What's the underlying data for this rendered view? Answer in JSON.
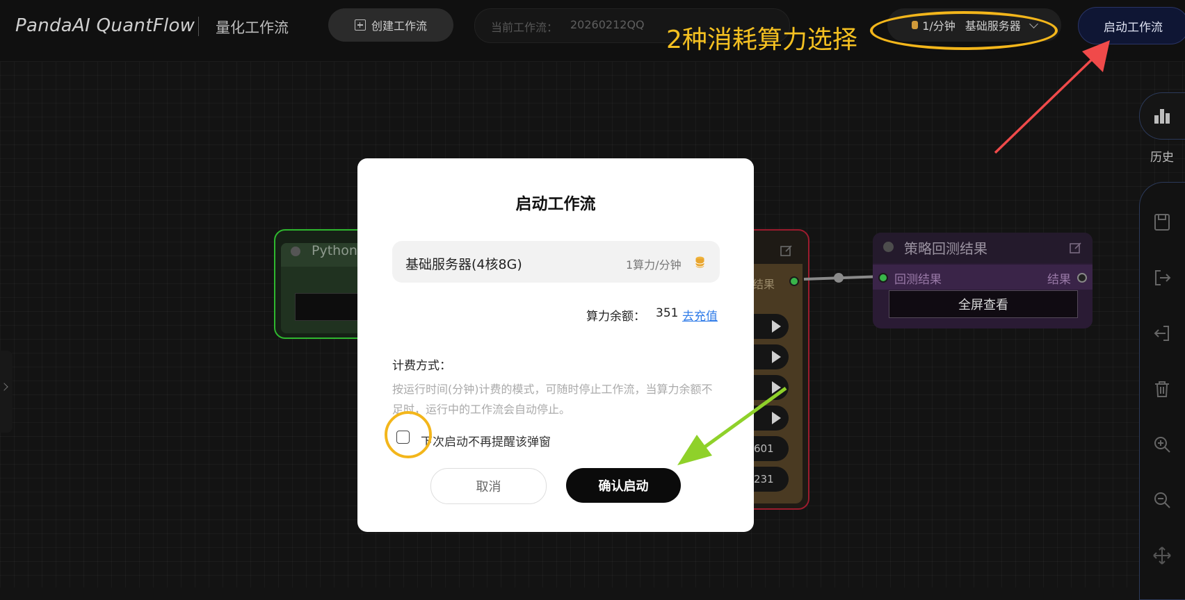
{
  "header": {
    "logo": "PandaAI QuantFlow",
    "subtitle": "量化工作流",
    "create_label": "创建工作流",
    "current_label": "当前工作流：",
    "current_value": "20260212QQ",
    "server_rate": "1/分钟",
    "server_name": "基础服务器",
    "start_label": "启动工作流"
  },
  "annotation": {
    "text": "2种消耗算力选择",
    "color": "#f3b61b"
  },
  "sidebar": {
    "history_label": "历史",
    "icons": [
      "bar-chart-icon",
      "save-icon",
      "export-icon",
      "import-icon",
      "trash-icon",
      "zoom-in-icon",
      "zoom-out-icon",
      "move-icon"
    ]
  },
  "canvas": {
    "python_node_title": "Python",
    "red_node_output": "结果",
    "pill_values": [
      "601",
      "231"
    ],
    "result_node": {
      "title": "策略回测结果",
      "input_label": "回测结果",
      "output_label": "结果",
      "button_label": "全屏查看"
    }
  },
  "modal": {
    "title": "启动工作流",
    "server_name": "基础服务器(4核8G)",
    "server_price": "1算力/分钟",
    "balance_label": "算力余额：",
    "balance_value": "351",
    "recharge_label": "去充值",
    "billing_label": "计费方式：",
    "billing_desc": "按运行时间(分钟)计费的模式，可随时停止工作流，当算力余额不足时，运行中的工作流会自动停止。",
    "dont_remind_label": "下次启动不再提醒该弹窗",
    "dont_remind_checked": false,
    "cancel_label": "取消",
    "confirm_label": "确认启动"
  },
  "colors": {
    "accent_yellow": "#f3b61b",
    "arrow_red": "#f04a4a",
    "arrow_green": "#8fd12a",
    "link_blue": "#2f7be8"
  }
}
